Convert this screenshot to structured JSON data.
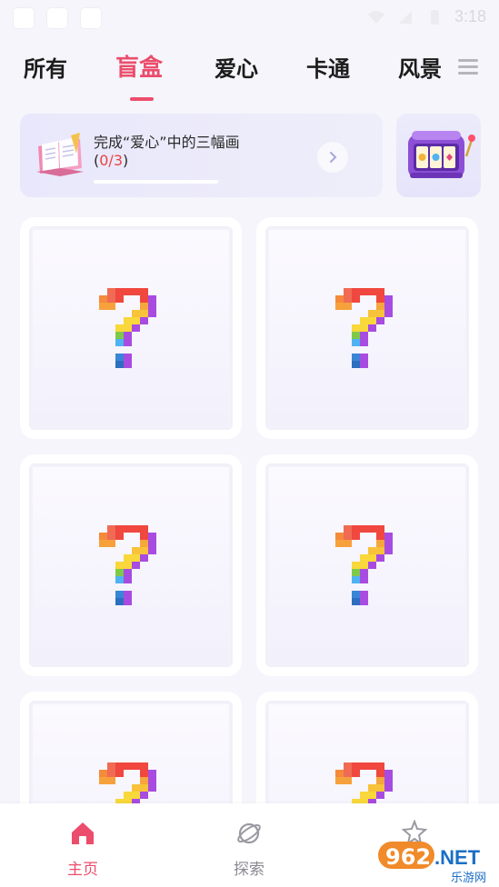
{
  "status_bar": {
    "time": "3:18"
  },
  "tabs": [
    {
      "label": "所有",
      "active": false
    },
    {
      "label": "盲盒",
      "active": true
    },
    {
      "label": "爱心",
      "active": false
    },
    {
      "label": "卡通",
      "active": false
    },
    {
      "label": "风景",
      "active": false
    }
  ],
  "task": {
    "title": "完成“爱心”中的三幅画",
    "progress_prefix": "(",
    "progress_value": "0/3",
    "progress_suffix": ")",
    "progress_fraction": 0
  },
  "cards": [
    {
      "label": "?"
    },
    {
      "label": "?"
    },
    {
      "label": "?"
    },
    {
      "label": "?"
    },
    {
      "label": "?"
    },
    {
      "label": "?"
    }
  ],
  "bottom_nav": [
    {
      "label": "主页",
      "icon": "home-icon",
      "active": true
    },
    {
      "label": "探索",
      "icon": "planet-icon",
      "active": false
    },
    {
      "label": "",
      "icon": "star-person-icon",
      "active": false
    }
  ],
  "watermark": {
    "number": "962",
    "suffix": ".NET",
    "sub": "乐游网"
  },
  "colors": {
    "accent": "#ec4d6c",
    "progress_red": "#e8453f",
    "background": "#f5f5fb"
  }
}
